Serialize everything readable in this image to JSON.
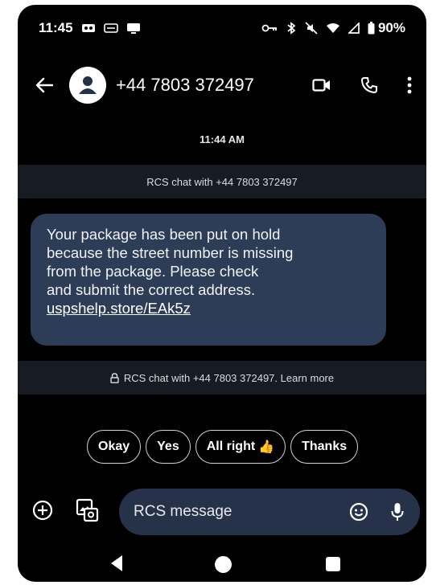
{
  "status_bar": {
    "time": "11:45",
    "battery": "90%",
    "left_icons": [
      "cast-icon",
      "voicemail-icon",
      "screen-icon"
    ],
    "right_icons": [
      "key-icon",
      "bluetooth-icon",
      "mute-icon",
      "wifi-icon",
      "signal-icon",
      "battery-icon"
    ]
  },
  "app_bar": {
    "contact": "+44 7803 372497",
    "back_icon": "back-arrow-icon",
    "actions": [
      "video-call-icon",
      "phone-icon",
      "more-vert-icon"
    ]
  },
  "conversation": {
    "timestamp": "11:44 AM",
    "rcs_banner_top": "RCS chat with +44 7803 372497",
    "message": {
      "lines": [
        "Your package has been put on hold",
        "because the street number is missing",
        "from the package. Please check",
        "and submit the correct address."
      ],
      "link": "uspshelp.store/EAk5z"
    },
    "rcs_banner_bottom": "RCS chat with +44 7803 372497. Learn more"
  },
  "smart_replies": [
    {
      "label": "Okay"
    },
    {
      "label": "Yes"
    },
    {
      "label": "All right",
      "emoji": "👍"
    },
    {
      "label": "Thanks"
    }
  ],
  "composer": {
    "placeholder": "RCS message"
  },
  "colors": {
    "background": "#000000",
    "bubble": "#2d3c57",
    "banner": "#161b24",
    "input": "#26324a"
  }
}
